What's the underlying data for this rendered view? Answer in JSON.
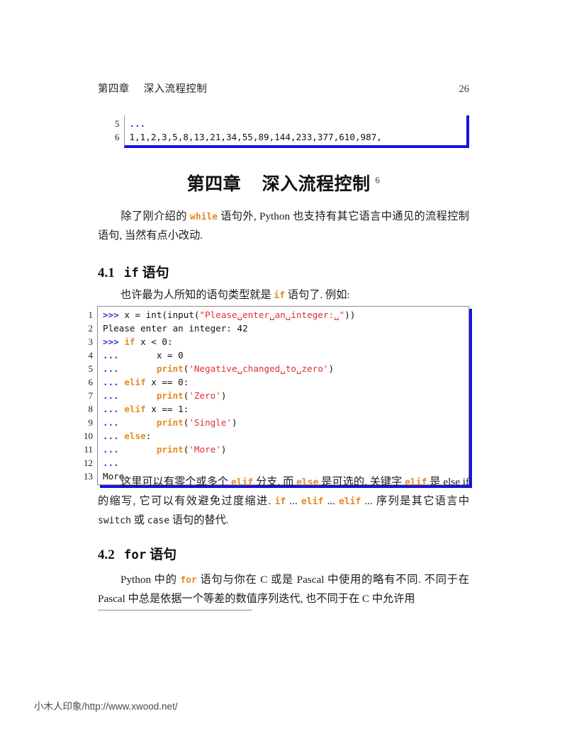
{
  "header": {
    "chapter_label": "第四章",
    "chapter_name": "深入流程控制",
    "page_number": "26"
  },
  "listing_top": {
    "line_numbers": [
      "5",
      "6"
    ],
    "lines": [
      {
        "number": "5",
        "tokens": [
          {
            "text": "...",
            "type": "dots"
          }
        ]
      },
      {
        "number": "6",
        "tokens": [
          {
            "text": "1,1,2,3,5,8,13,21,34,55,89,144,233,377,610,987,",
            "type": "plain"
          }
        ]
      }
    ]
  },
  "chapter_title": {
    "number": "第四章",
    "name": "深入流程控制",
    "footnote_marker": "6"
  },
  "paragraphs": {
    "intro": {
      "part1": "除了刚介绍的 ",
      "kw1": "while",
      "part2": " 语句外, Python 也支持有其它语言中通见的流程控制语句, 当然有点小改动."
    },
    "if_intro": {
      "part1": "也许最为人所知的语句类型就是 ",
      "kw1": "if",
      "part2": " 语句了. 例如:"
    },
    "elif_note": {
      "part1": "这里可以有零个或多个 ",
      "kw1": "elif",
      "part2": " 分支, 而 ",
      "kw2": "else",
      "part3": " 是可选的. 关键字 ",
      "kw3": "elif",
      "part4": " 是 else if 的缩写, 它可以有效避免过度缩进. ",
      "kw4": "if",
      "part5": " ... ",
      "kw5": "elif",
      "part6": " ... ",
      "kw6": "elif",
      "part7": " ... 序列是其它语言中 ",
      "mono1": "switch",
      "part8": " 或 ",
      "mono2": "case",
      "part9": " 语句的替代."
    },
    "for_intro": {
      "part1": "Python 中的 ",
      "kw1": "for",
      "part2": " 语句与你在 C 或是 Pascal 中使用的略有不同. 不同于在 Pascal 中总是依据一个等差的数值序列迭代, 也不同于在 C 中允许用"
    }
  },
  "sections": [
    {
      "number": "4.1",
      "code_name": "if",
      "suffix": "语句"
    },
    {
      "number": "4.2",
      "code_name": "for",
      "suffix": "语句"
    }
  ],
  "listing_main": {
    "lines": [
      {
        "number": "1",
        "tokens": [
          {
            "text": ">>>",
            "type": "prompt"
          },
          {
            "text": " x = int(input(",
            "type": "plain"
          },
          {
            "text": "\"Please␣enter␣an␣integer:␣\"",
            "type": "str"
          },
          {
            "text": "))",
            "type": "plain"
          }
        ]
      },
      {
        "number": "2",
        "tokens": [
          {
            "text": "Please enter an integer: 42",
            "type": "plain"
          }
        ]
      },
      {
        "number": "3",
        "tokens": [
          {
            "text": ">>>",
            "type": "prompt"
          },
          {
            "text": " ",
            "type": "plain"
          },
          {
            "text": "if",
            "type": "kw"
          },
          {
            "text": " x < 0:",
            "type": "plain"
          }
        ]
      },
      {
        "number": "4",
        "tokens": [
          {
            "text": "...",
            "type": "dots"
          },
          {
            "text": "       x = 0",
            "type": "plain"
          }
        ]
      },
      {
        "number": "5",
        "tokens": [
          {
            "text": "...",
            "type": "dots"
          },
          {
            "text": "       ",
            "type": "plain"
          },
          {
            "text": "print",
            "type": "fn"
          },
          {
            "text": "(",
            "type": "plain"
          },
          {
            "text": "'Negative␣changed␣to␣zero'",
            "type": "str"
          },
          {
            "text": ")",
            "type": "plain"
          }
        ]
      },
      {
        "number": "6",
        "tokens": [
          {
            "text": "...",
            "type": "dots"
          },
          {
            "text": " ",
            "type": "plain"
          },
          {
            "text": "elif",
            "type": "kw"
          },
          {
            "text": " x == 0:",
            "type": "plain"
          }
        ]
      },
      {
        "number": "7",
        "tokens": [
          {
            "text": "...",
            "type": "dots"
          },
          {
            "text": "       ",
            "type": "plain"
          },
          {
            "text": "print",
            "type": "fn"
          },
          {
            "text": "(",
            "type": "plain"
          },
          {
            "text": "'Zero'",
            "type": "str"
          },
          {
            "text": ")",
            "type": "plain"
          }
        ]
      },
      {
        "number": "8",
        "tokens": [
          {
            "text": "...",
            "type": "dots"
          },
          {
            "text": " ",
            "type": "plain"
          },
          {
            "text": "elif",
            "type": "kw"
          },
          {
            "text": " x == 1:",
            "type": "plain"
          }
        ]
      },
      {
        "number": "9",
        "tokens": [
          {
            "text": "...",
            "type": "dots"
          },
          {
            "text": "       ",
            "type": "plain"
          },
          {
            "text": "print",
            "type": "fn"
          },
          {
            "text": "(",
            "type": "plain"
          },
          {
            "text": "'Single'",
            "type": "str"
          },
          {
            "text": ")",
            "type": "plain"
          }
        ]
      },
      {
        "number": "10",
        "tokens": [
          {
            "text": "...",
            "type": "dots"
          },
          {
            "text": " ",
            "type": "plain"
          },
          {
            "text": "else",
            "type": "kw"
          },
          {
            "text": ":",
            "type": "plain"
          }
        ]
      },
      {
        "number": "11",
        "tokens": [
          {
            "text": "...",
            "type": "dots"
          },
          {
            "text": "       ",
            "type": "plain"
          },
          {
            "text": "print",
            "type": "fn"
          },
          {
            "text": "(",
            "type": "plain"
          },
          {
            "text": "'More'",
            "type": "str"
          },
          {
            "text": ")",
            "type": "plain"
          }
        ]
      },
      {
        "number": "12",
        "tokens": [
          {
            "text": "...",
            "type": "dots"
          }
        ]
      },
      {
        "number": "13",
        "tokens": [
          {
            "text": "More",
            "type": "plain"
          }
        ]
      }
    ]
  },
  "watermark": {
    "text": "小木人印象/http://www.xwood.net/"
  },
  "colors": {
    "prompt_blue": "#3333cc",
    "keyword_orange": "#e58a20",
    "string_red": "#e03030",
    "frame_blue": "#1414e0",
    "frame_gray": "#8f8f8f"
  }
}
